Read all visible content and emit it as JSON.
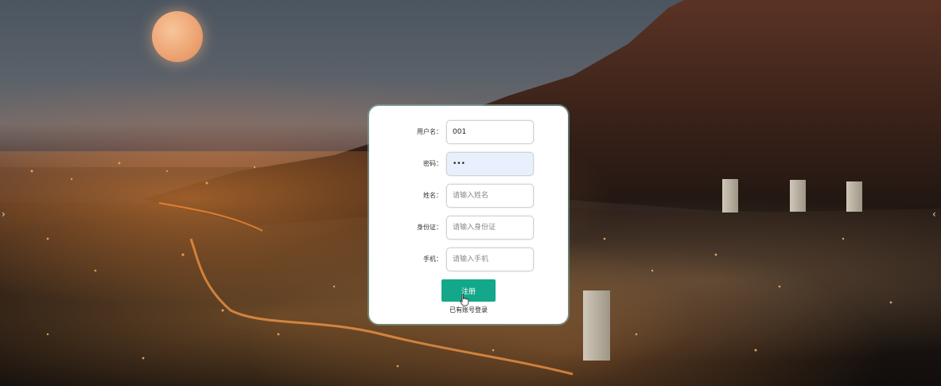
{
  "background": {
    "description_colors": {
      "sky": "#545b63",
      "city_light": "#ff9a45",
      "mountain": "#3a2018"
    }
  },
  "form": {
    "fields": [
      {
        "label": "用户名：",
        "value": "001",
        "placeholder": "",
        "type": "text"
      },
      {
        "label": "密码：",
        "value": "•••",
        "placeholder": "",
        "type": "password"
      },
      {
        "label": "姓名：",
        "value": "",
        "placeholder": "请输入姓名",
        "type": "text"
      },
      {
        "label": "身份证：",
        "value": "",
        "placeholder": "请输入身份证",
        "type": "text"
      },
      {
        "label": "手机：",
        "value": "",
        "placeholder": "请输入手机",
        "type": "text"
      }
    ],
    "submit_label": "注册",
    "login_link": "已有账号登录",
    "accent_color": "#14a88a"
  },
  "nav": {
    "right_arrow_icon": "chevron-left-icon"
  }
}
